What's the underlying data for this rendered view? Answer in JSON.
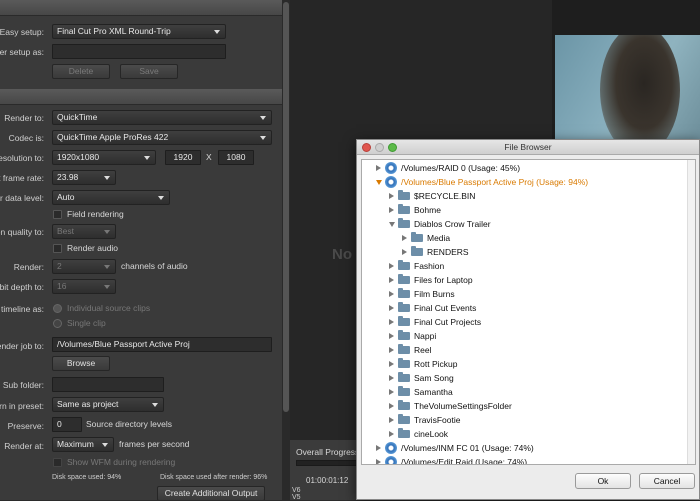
{
  "left_panel": {
    "preset": {
      "easy_setup_label": "Easy setup:",
      "easy_setup_value": "Final Cut Pro XML Round-Trip",
      "save_setup_label": "Save user setup as:",
      "save_setup_value": "",
      "delete_label": "Delete",
      "save_label": "Save"
    },
    "render": {
      "render_to_label": "Render to:",
      "render_to_value": "QuickTime",
      "codec_label": "Codec is:",
      "codec_value": "QuickTime Apple ProRes 422",
      "resolution_label": "Resolution to:",
      "resolution_value": "1920x1080",
      "width": "1920",
      "x": "X",
      "height": "1080",
      "frame_rate_label": "Render at frame rate:",
      "frame_rate_value": "23.98",
      "data_level_label": "Set video/color data level:",
      "data_level_value": "Auto",
      "field_rendering": "Field rendering",
      "quality_label": "Compression quality to:",
      "quality_value": "Best",
      "render_audio": "Render audio",
      "render_label": "Render:",
      "channels_value": "2",
      "channels_suffix": "channels of audio",
      "bit_depth_label": "Render at bit depth to:",
      "bit_depth_value": "16",
      "timeline_label": "Render timeline as:",
      "individual_clips": "Individual source clips",
      "single_clip": "Single clip",
      "render_job_label": "Render job to:",
      "render_job_value": "/Volumes/Blue Passport Active Proj",
      "browse": "Browse",
      "subfolder_label": "Sub folder:",
      "subfolder_value": "",
      "preset_label": "Return in preset:",
      "preset_value": "Same as project",
      "preserve_label": "Preserve:",
      "preserve_value": "0",
      "preserve_suffix": "Source directory levels",
      "render_at_label": "Render at:",
      "render_at_value": "Maximum",
      "render_at_suffix": "frames per second",
      "show_wfm": "Show WFM during rendering",
      "disk_used": "Disk space used: 94%",
      "disk_after": "Disk space used after render: 96%",
      "create_output": "Create Additional Output"
    }
  },
  "viewer": {
    "ghost_text": "No",
    "overall_progress": "Overall Progress",
    "timecode": "01:00:01:12",
    "track_v6": "V6",
    "track_v5": "V5"
  },
  "dialog": {
    "title": "File Browser",
    "ok": "Ok",
    "cancel": "Cancel",
    "items": [
      {
        "label": "/Volumes/RAID 0 (Usage: 45%)",
        "type": "disk",
        "indent": 0,
        "expanded": false
      },
      {
        "label": "/Volumes/Blue Passport Active Proj (Usage: 94%)",
        "type": "disk",
        "indent": 0,
        "expanded": true,
        "selected": true
      },
      {
        "label": "$RECYCLE.BIN",
        "type": "folder",
        "indent": 1,
        "expanded": false
      },
      {
        "label": "Bohme",
        "type": "folder",
        "indent": 1,
        "expanded": false
      },
      {
        "label": "Diablos Crow Trailer",
        "type": "folder",
        "indent": 1,
        "expanded": true
      },
      {
        "label": "Media",
        "type": "folder",
        "indent": 2,
        "expanded": false
      },
      {
        "label": "RENDERS",
        "type": "folder",
        "indent": 2,
        "expanded": false
      },
      {
        "label": "Fashion",
        "type": "folder",
        "indent": 1,
        "expanded": false
      },
      {
        "label": "Files for Laptop",
        "type": "folder",
        "indent": 1,
        "expanded": false
      },
      {
        "label": "Film Burns",
        "type": "folder",
        "indent": 1,
        "expanded": false
      },
      {
        "label": "Final Cut Events",
        "type": "folder",
        "indent": 1,
        "expanded": false
      },
      {
        "label": "Final Cut Projects",
        "type": "folder",
        "indent": 1,
        "expanded": false
      },
      {
        "label": "Nappi",
        "type": "folder",
        "indent": 1,
        "expanded": false
      },
      {
        "label": "Reel",
        "type": "folder",
        "indent": 1,
        "expanded": false
      },
      {
        "label": "Rott Pickup",
        "type": "folder",
        "indent": 1,
        "expanded": false
      },
      {
        "label": "Sam Song",
        "type": "folder",
        "indent": 1,
        "expanded": false
      },
      {
        "label": "Samantha",
        "type": "folder",
        "indent": 1,
        "expanded": false
      },
      {
        "label": "TheVolumeSettingsFolder",
        "type": "folder",
        "indent": 1,
        "expanded": false
      },
      {
        "label": "TravisFootie",
        "type": "folder",
        "indent": 1,
        "expanded": false
      },
      {
        "label": "cineLook",
        "type": "folder",
        "indent": 1,
        "expanded": false
      },
      {
        "label": "/Volumes/INM FC 01 (Usage: 74%)",
        "type": "disk",
        "indent": 0,
        "expanded": false
      },
      {
        "label": "/Volumes/Edit Raid (Usage: 74%)",
        "type": "disk",
        "indent": 0,
        "expanded": false
      }
    ]
  },
  "colors": {
    "accent": "#d97a00",
    "folder": "#6d8ea8",
    "disk": "#2f6fb8"
  }
}
